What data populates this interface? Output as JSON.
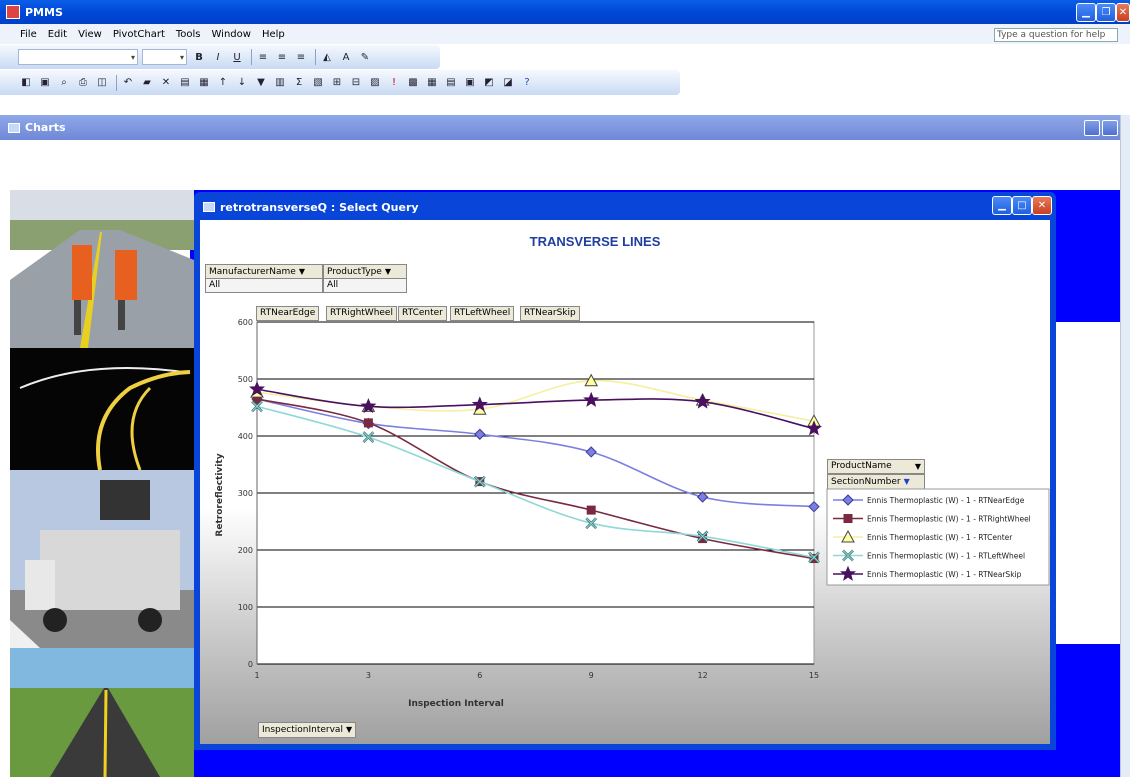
{
  "app": {
    "title": "PMMS"
  },
  "menu": [
    "File",
    "Edit",
    "View",
    "PivotChart",
    "Tools",
    "Window",
    "Help"
  ],
  "help": {
    "placeholder": "Type a question for help"
  },
  "mdi": {
    "title": "Charts"
  },
  "query_window": {
    "title": "retrotransverseQ : Select Query"
  },
  "filters": [
    {
      "label": "ManufacturerName",
      "value": "All"
    },
    {
      "label": "ProductType",
      "value": "All"
    }
  ],
  "data_fields": [
    "RTNearEdge",
    "RTRightWheel",
    "RTCenter",
    "RTLeftWheel",
    "RTNearSkip"
  ],
  "series_fields": [
    "ProductName",
    "SectionNumber"
  ],
  "category_field": "InspectionInterval",
  "chart_data": {
    "type": "line",
    "title": "TRANSVERSE LINES",
    "xlabel": "Inspection Interval",
    "ylabel": "Retroreflectivity",
    "categories": [
      "1",
      "3",
      "6",
      "9",
      "12",
      "15"
    ],
    "ylim": [
      0,
      600
    ],
    "yticks": [
      0,
      100,
      200,
      300,
      400,
      500,
      600
    ],
    "grid": true,
    "legend_position": "right",
    "series": [
      {
        "name": "Ennis Thermoplastic (W) - 1 - RTNearEdge",
        "values": [
          465,
          422,
          403,
          372,
          293,
          276
        ],
        "color": "#7b7fe0",
        "marker": "diamond"
      },
      {
        "name": "Ennis Thermoplastic (W) - 1 - RTRightWheel",
        "values": [
          465,
          423,
          320,
          270,
          220,
          185
        ],
        "color": "#7a2a40",
        "marker": "square"
      },
      {
        "name": "Ennis Thermoplastic (W) - 1 - RTCenter",
        "values": [
          477,
          452,
          447,
          497,
          463,
          426
        ],
        "color": "#f4f0a0",
        "marker": "triangle"
      },
      {
        "name": "Ennis Thermoplastic (W) - 1 - RTLeftWheel",
        "values": [
          452,
          398,
          320,
          247,
          224,
          187
        ],
        "color": "#90d8d8",
        "marker": "x"
      },
      {
        "name": "Ennis Thermoplastic (W) - 1 - RTNearSkip",
        "values": [
          482,
          452,
          455,
          463,
          460,
          413
        ],
        "color": "#4a1060",
        "marker": "star"
      }
    ]
  }
}
